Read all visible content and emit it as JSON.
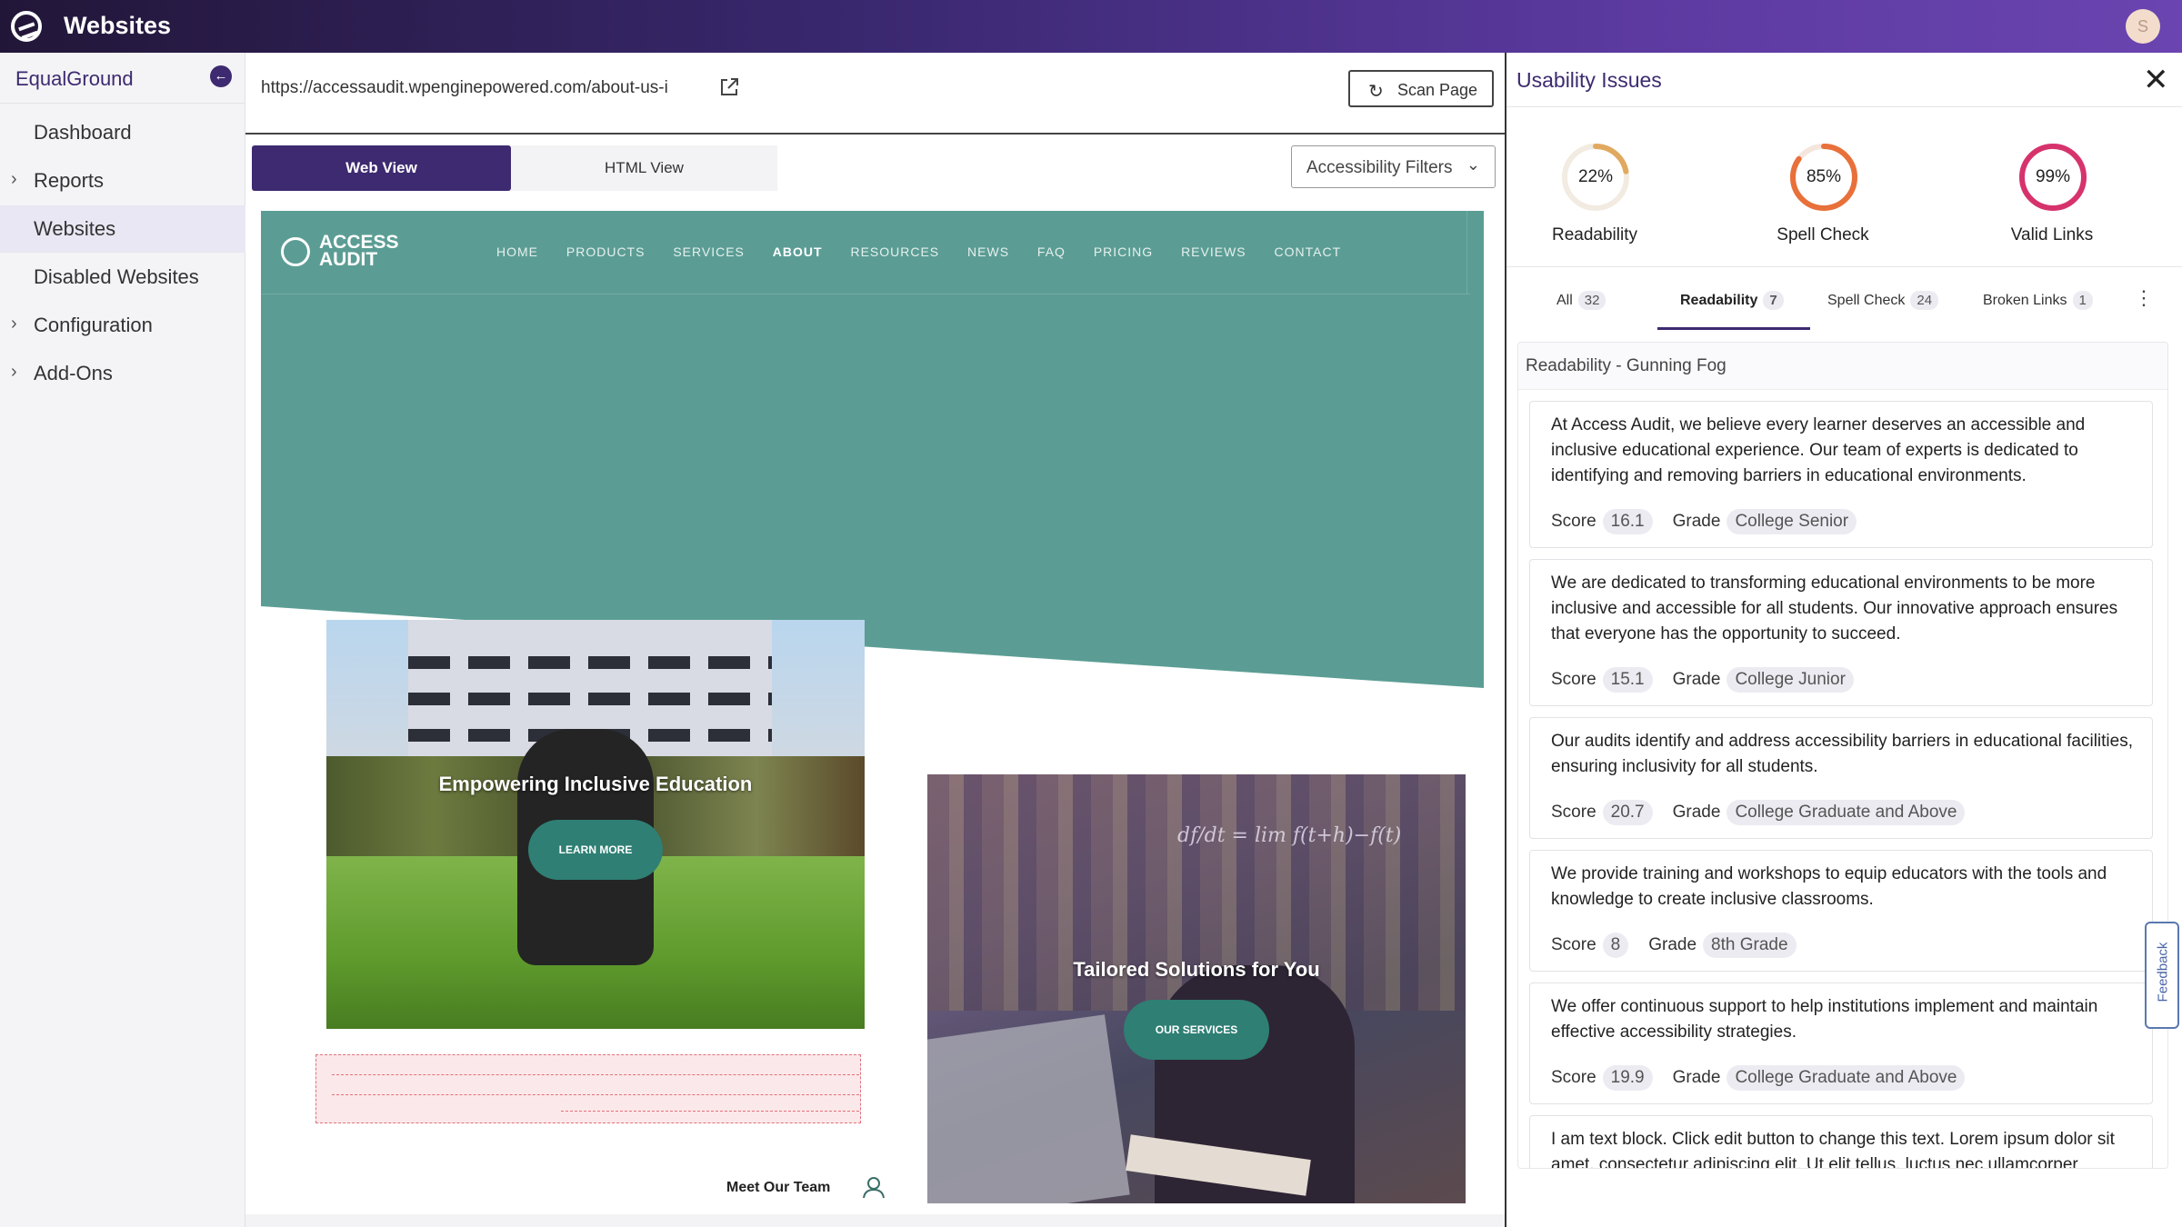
{
  "app": {
    "title": "Websites",
    "user_initial": "S"
  },
  "sidebar": {
    "org_name": "EqualGround",
    "items": [
      {
        "label": "Dashboard",
        "expandable": false,
        "active": false
      },
      {
        "label": "Reports",
        "expandable": true,
        "active": false
      },
      {
        "label": "Websites",
        "expandable": false,
        "active": true
      },
      {
        "label": "Disabled Websites",
        "expandable": false,
        "active": false
      },
      {
        "label": "Configuration",
        "expandable": true,
        "active": false
      },
      {
        "label": "Add-Ons",
        "expandable": true,
        "active": false
      }
    ]
  },
  "urlbar": {
    "url": "https://accessaudit.wpenginepowered.com/about-us-i",
    "scan_label": "Scan Page"
  },
  "view_tabs": {
    "web": "Web View",
    "html": "HTML View",
    "filters": "Accessibility Filters"
  },
  "preview": {
    "brand_line1": "ACCESS",
    "brand_line2": "AUDIT",
    "nav": [
      "HOME",
      "PRODUCTS",
      "SERVICES",
      "ABOUT",
      "RESOURCES",
      "NEWS",
      "FAQ",
      "PRICING",
      "REVIEWS",
      "CONTACT"
    ],
    "card1_title": "Empowering Inclusive Education",
    "card1_button": "LEARN MORE",
    "card2_title": "Tailored Solutions for You",
    "card2_button": "OUR SERVICES",
    "meet_team": "Meet Our Team"
  },
  "panel": {
    "title": "Usability Issues",
    "gauges": [
      {
        "label": "Readability",
        "value": "22%",
        "fraction": 0.22,
        "color": "#e1a95f"
      },
      {
        "label": "Spell Check",
        "value": "85%",
        "fraction": 0.85,
        "color": "#e8703a"
      },
      {
        "label": "Valid Links",
        "value": "99%",
        "fraction": 0.99,
        "color": "#d6336c"
      }
    ],
    "tabs": [
      {
        "label": "All",
        "count": "32"
      },
      {
        "label": "Readability",
        "count": "7"
      },
      {
        "label": "Spell Check",
        "count": "24"
      },
      {
        "label": "Broken Links",
        "count": "1"
      }
    ],
    "section_title": "Readability - Gunning Fog",
    "score_label": "Score",
    "grade_label": "Grade",
    "issues": [
      {
        "text": "At Access Audit, we believe every learner deserves an accessible and inclusive educational experience. Our team of experts is dedicated to identifying and removing barriers in educational environments.",
        "score": "16.1",
        "grade": "College Senior"
      },
      {
        "text": "We are dedicated to transforming educational environments to be more inclusive and accessible for all students. Our innovative approach ensures that everyone has the opportunity to succeed.",
        "score": "15.1",
        "grade": "College Junior"
      },
      {
        "text": "Our audits identify and address accessibility barriers in educational facilities, ensuring inclusivity for all students.",
        "score": "20.7",
        "grade": "College Graduate and Above"
      },
      {
        "text": "We provide training and workshops to equip educators with the tools and knowledge to create inclusive classrooms.",
        "score": "8",
        "grade": "8th Grade"
      },
      {
        "text": "We offer continuous support to help institutions implement and maintain effective accessibility strategies.",
        "score": "19.9",
        "grade": "College Graduate and Above"
      },
      {
        "text": "I am text block. Click edit button to change this text. Lorem ipsum dolor sit amet, consectetur adipiscing elit. Ut elit tellus, luctus nec ullamcorper",
        "score": "",
        "grade": ""
      }
    ],
    "feedback": "Feedback"
  }
}
